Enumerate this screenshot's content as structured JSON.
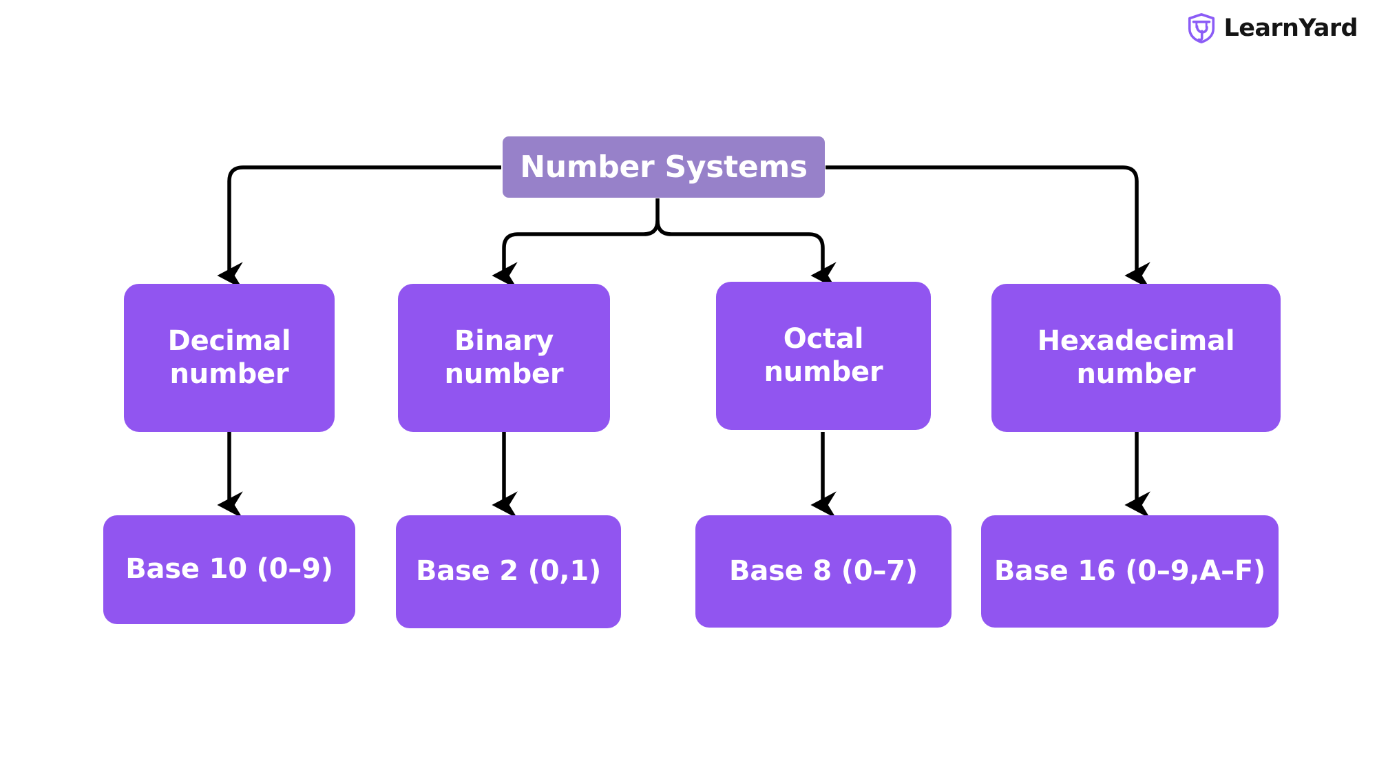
{
  "brand": {
    "name": "LearnYard",
    "logo_icon": "shield-y-logo-icon",
    "mark_color": "#8b5cf6",
    "text_color": "#141414"
  },
  "diagram": {
    "type": "hierarchy-tree",
    "title": "Number Systems",
    "root": {
      "id": "root",
      "label": "Number Systems",
      "color": "#9781c9",
      "text_color": "#ffffff"
    },
    "branches": [
      {
        "id": "decimal",
        "label": "Decimal\nnumber",
        "color": "#9155f0",
        "text_color": "#ffffff",
        "child": {
          "id": "base-10",
          "label": "Base 10 (0–9)",
          "color": "#9155f0",
          "text_color": "#ffffff"
        }
      },
      {
        "id": "binary",
        "label": "Binary\nnumber",
        "color": "#9155f0",
        "text_color": "#ffffff",
        "child": {
          "id": "base-2",
          "label": "Base 2 (0,1)",
          "color": "#9155f0",
          "text_color": "#ffffff"
        }
      },
      {
        "id": "octal",
        "label": "Octal\nnumber",
        "color": "#9155f0",
        "text_color": "#ffffff",
        "child": {
          "id": "base-8",
          "label": "Base 8 (0–7)",
          "color": "#9155f0",
          "text_color": "#ffffff"
        }
      },
      {
        "id": "hexadecimal",
        "label": "Hexadecimal\nnumber",
        "color": "#9155f0",
        "text_color": "#ffffff",
        "child": {
          "id": "base-16",
          "label": "Base 16 (0–9,A–F)",
          "color": "#9155f0",
          "text_color": "#ffffff"
        }
      }
    ],
    "connector_color": "#000000",
    "background_color": "#ffffff"
  }
}
